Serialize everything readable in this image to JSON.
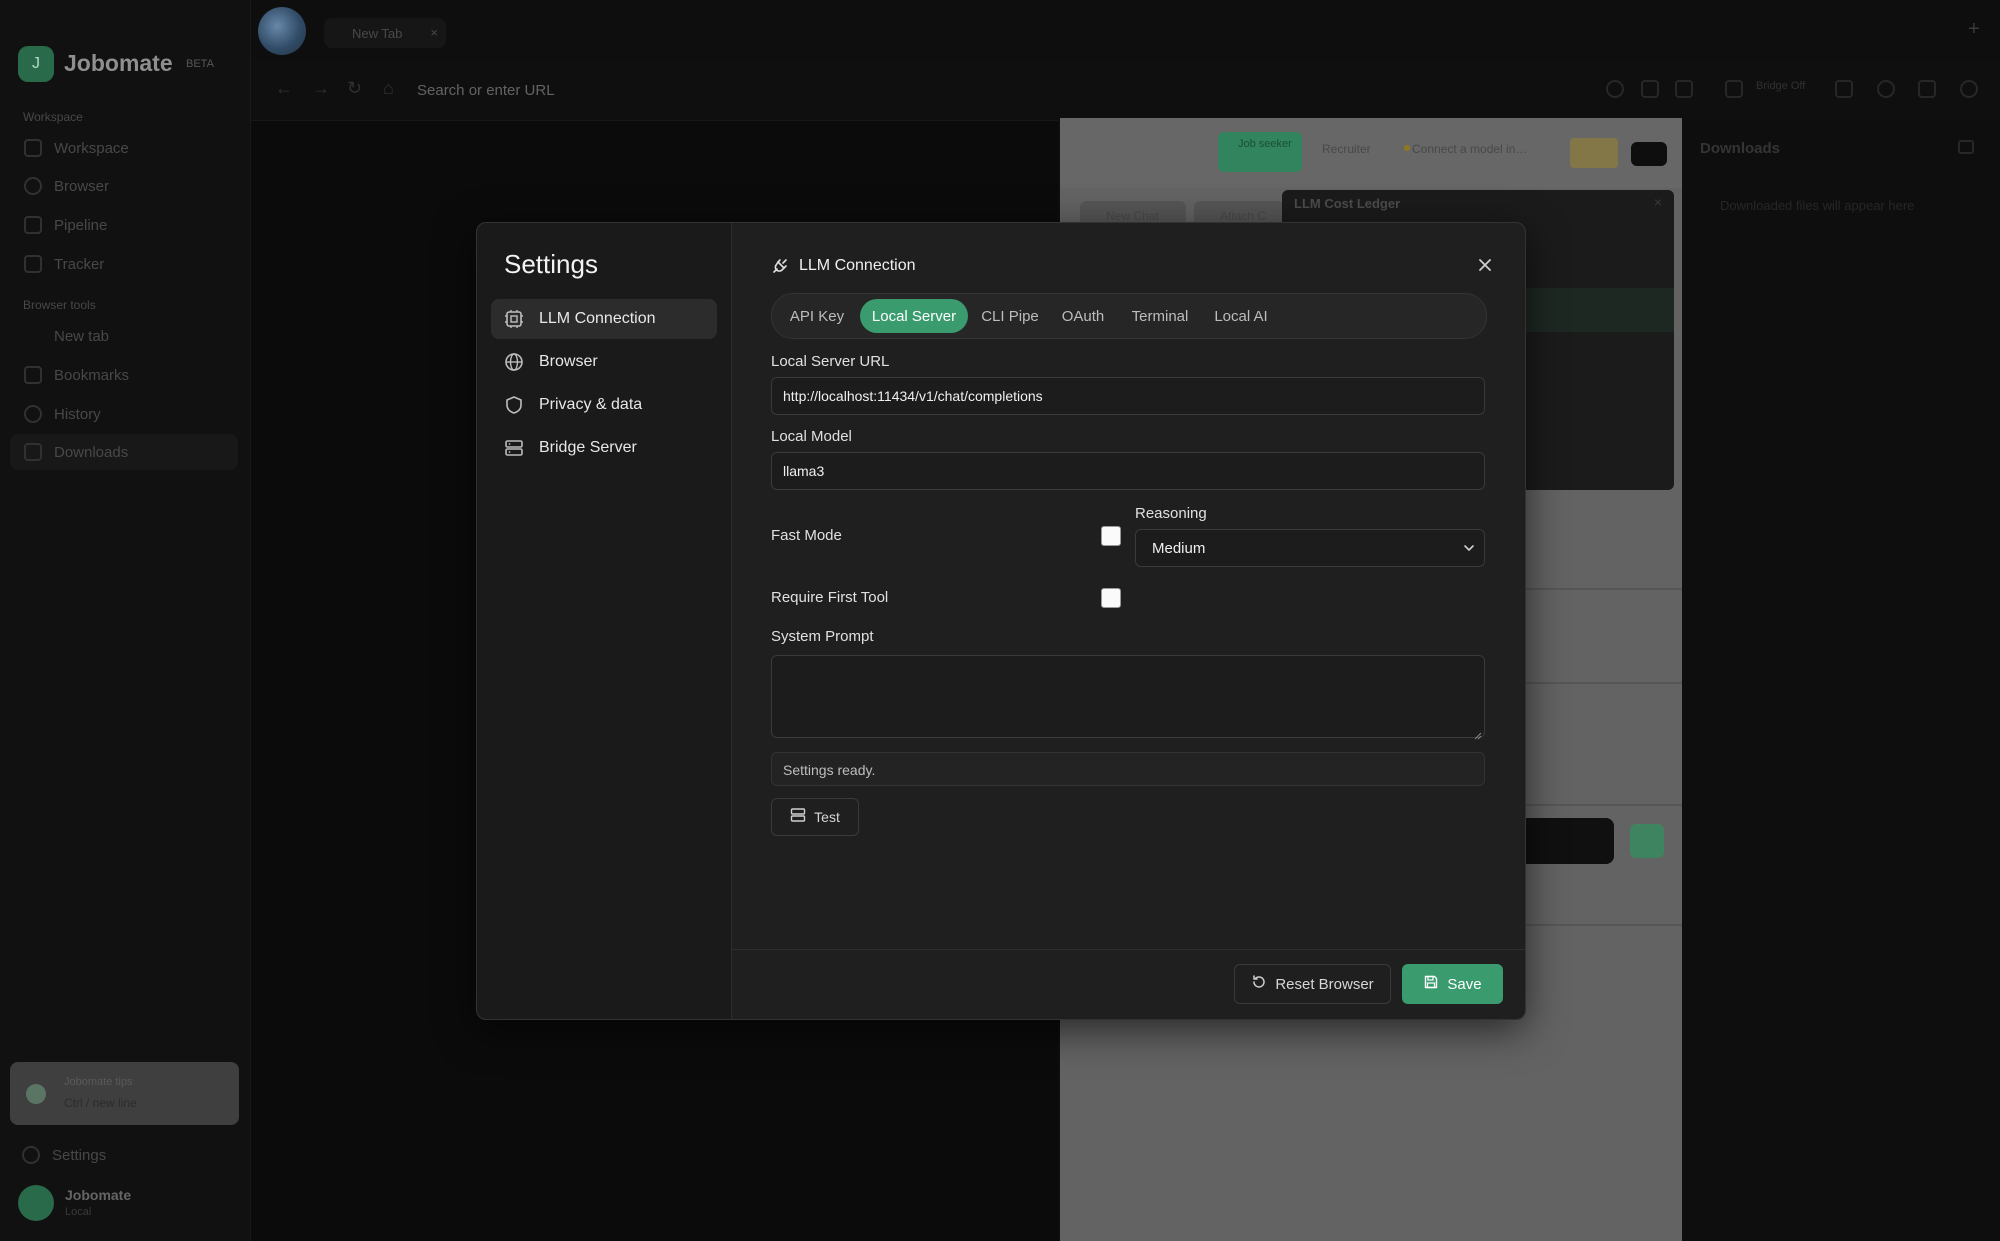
{
  "app": {
    "brand_name": "Jobomate",
    "brand_badge": "BETA",
    "brand_initial": "J"
  },
  "sidebar": {
    "workspace_heading": "Workspace",
    "workspace_items": [
      {
        "label": "Workspace"
      },
      {
        "label": "Browser"
      },
      {
        "label": "Pipeline"
      },
      {
        "label": "Tracker"
      }
    ],
    "tools_heading": "Browser tools",
    "tools_items": [
      {
        "label": "New tab"
      },
      {
        "label": "Bookmarks"
      },
      {
        "label": "History"
      },
      {
        "label": "Downloads"
      }
    ],
    "promo_line1": "Jobomate tips",
    "promo_line2": "Ctrl / new line",
    "settings_label": "Settings",
    "user_name": "Jobomate",
    "user_sub": "Local"
  },
  "browser": {
    "tab_label": "New Tab",
    "url_placeholder": "Search or enter URL",
    "bridge_label": "Bridge Off"
  },
  "panel": {
    "job_label": "Job seeker",
    "recruiter_label": "Recruiter",
    "connect_label": "Connect a model in…",
    "new_chat_label": "New Chat",
    "attach_label": "Attach C",
    "ledger_title": "LLM Cost Ledger"
  },
  "downloads": {
    "title": "Downloads",
    "empty_text": "Downloaded files will appear here"
  },
  "settings_modal": {
    "title": "Settings",
    "nav": [
      {
        "label": "LLM Connection",
        "icon": "chip-icon",
        "active": true
      },
      {
        "label": "Browser",
        "icon": "globe-icon",
        "active": false
      },
      {
        "label": "Privacy & data",
        "icon": "shield-icon",
        "active": false
      },
      {
        "label": "Bridge Server",
        "icon": "server-icon",
        "active": false
      }
    ],
    "section_title": "LLM Connection",
    "tabs": [
      {
        "label": "API Key",
        "active": false
      },
      {
        "label": "Local Server",
        "active": true
      },
      {
        "label": "CLI Pipe",
        "active": false
      },
      {
        "label": "OAuth",
        "active": false
      },
      {
        "label": "Terminal",
        "active": false
      },
      {
        "label": "Local AI",
        "active": false
      }
    ],
    "url_label": "Local Server URL",
    "url_value": "http://localhost:11434/v1/chat/completions",
    "model_label": "Local Model",
    "model_value": "llama3",
    "fast_mode_label": "Fast Mode",
    "fast_mode_checked": false,
    "reasoning_label": "Reasoning",
    "reasoning_value": "Medium",
    "require_tool_label": "Require First Tool",
    "require_tool_checked": false,
    "system_prompt_label": "System Prompt",
    "system_prompt_value": "",
    "status_text": "Settings ready.",
    "test_label": "Test",
    "reset_label": "Reset Browser",
    "save_label": "Save",
    "accent_color": "#3a9c6e"
  }
}
